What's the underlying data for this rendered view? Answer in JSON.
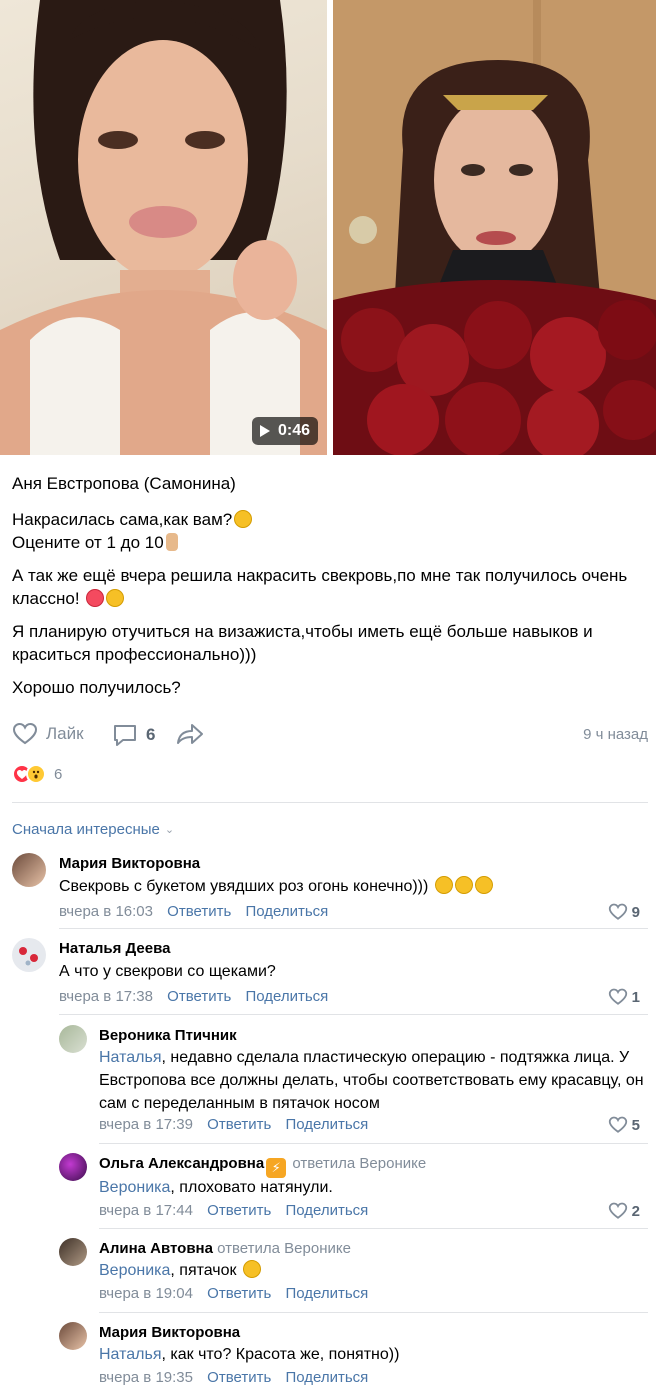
{
  "media": {
    "video_duration": "0:46"
  },
  "post": {
    "author": "Аня Евстропова (Самонина)",
    "paragraphs": [
      {
        "line1": "Накрасилась сама,как вам?",
        "line2": "Оцените от 1 до 10"
      },
      {
        "text": "А так же ещё вчера решила накрасить свекровь,по мне так получилось очень классно!"
      },
      {
        "text": "Я планирую отучиться на визажиста,чтобы иметь ещё больше навыков и краситься профессионально)))"
      },
      {
        "text": "Хорошо получилось?"
      }
    ],
    "like_label": "Лайк",
    "comments_count": "6",
    "time_ago": "9 ч назад",
    "reactions_count": "6"
  },
  "comments_section": {
    "sort_label": "Сначала интересные"
  },
  "comments": [
    {
      "name": "Мария Викторовна",
      "text": "Свекровь с букетом увядших роз огонь конечно)))",
      "time": "вчера в 16:03",
      "reply": "Ответить",
      "share": "Поделиться",
      "likes": "9"
    },
    {
      "name": "Наталья Деева",
      "text": "А что у свекрови со щеками?",
      "time": "вчера в 17:38",
      "reply": "Ответить",
      "share": "Поделиться",
      "likes": "1"
    }
  ],
  "replies": [
    {
      "name": "Вероника Птичник",
      "mention": "Наталья",
      "text": ", недавно сделала пластическую операцию - подтяжка лица. У Евстропова все должны делать, чтобы соответствовать ему красавцу, он сам с переделанным в пятачок носом",
      "time": "вчера в 17:39",
      "reply": "Ответить",
      "share": "Поделиться",
      "likes": "5"
    },
    {
      "name": "Ольга Александровна",
      "replied_to": "ответила Веронике",
      "mention": "Вероника",
      "text": ", плоховато натянули.",
      "time": "вчера в 17:44",
      "reply": "Ответить",
      "share": "Поделиться",
      "likes": "2"
    },
    {
      "name": "Алина Автовна",
      "replied_to": "ответила Веронике",
      "mention": "Вероника",
      "text": ", пятачок",
      "time": "вчера в 19:04",
      "reply": "Ответить",
      "share": "Поделиться"
    },
    {
      "name": "Мария Викторовна",
      "mention": "Наталья",
      "text": ", как что? Красота же, понятно))",
      "time": "вчера в 19:35",
      "reply": "Ответить",
      "share": "Поделиться"
    }
  ],
  "colors": {
    "link": "#4a76a8",
    "secondary": "#818c99",
    "heart": "#ff3347"
  }
}
